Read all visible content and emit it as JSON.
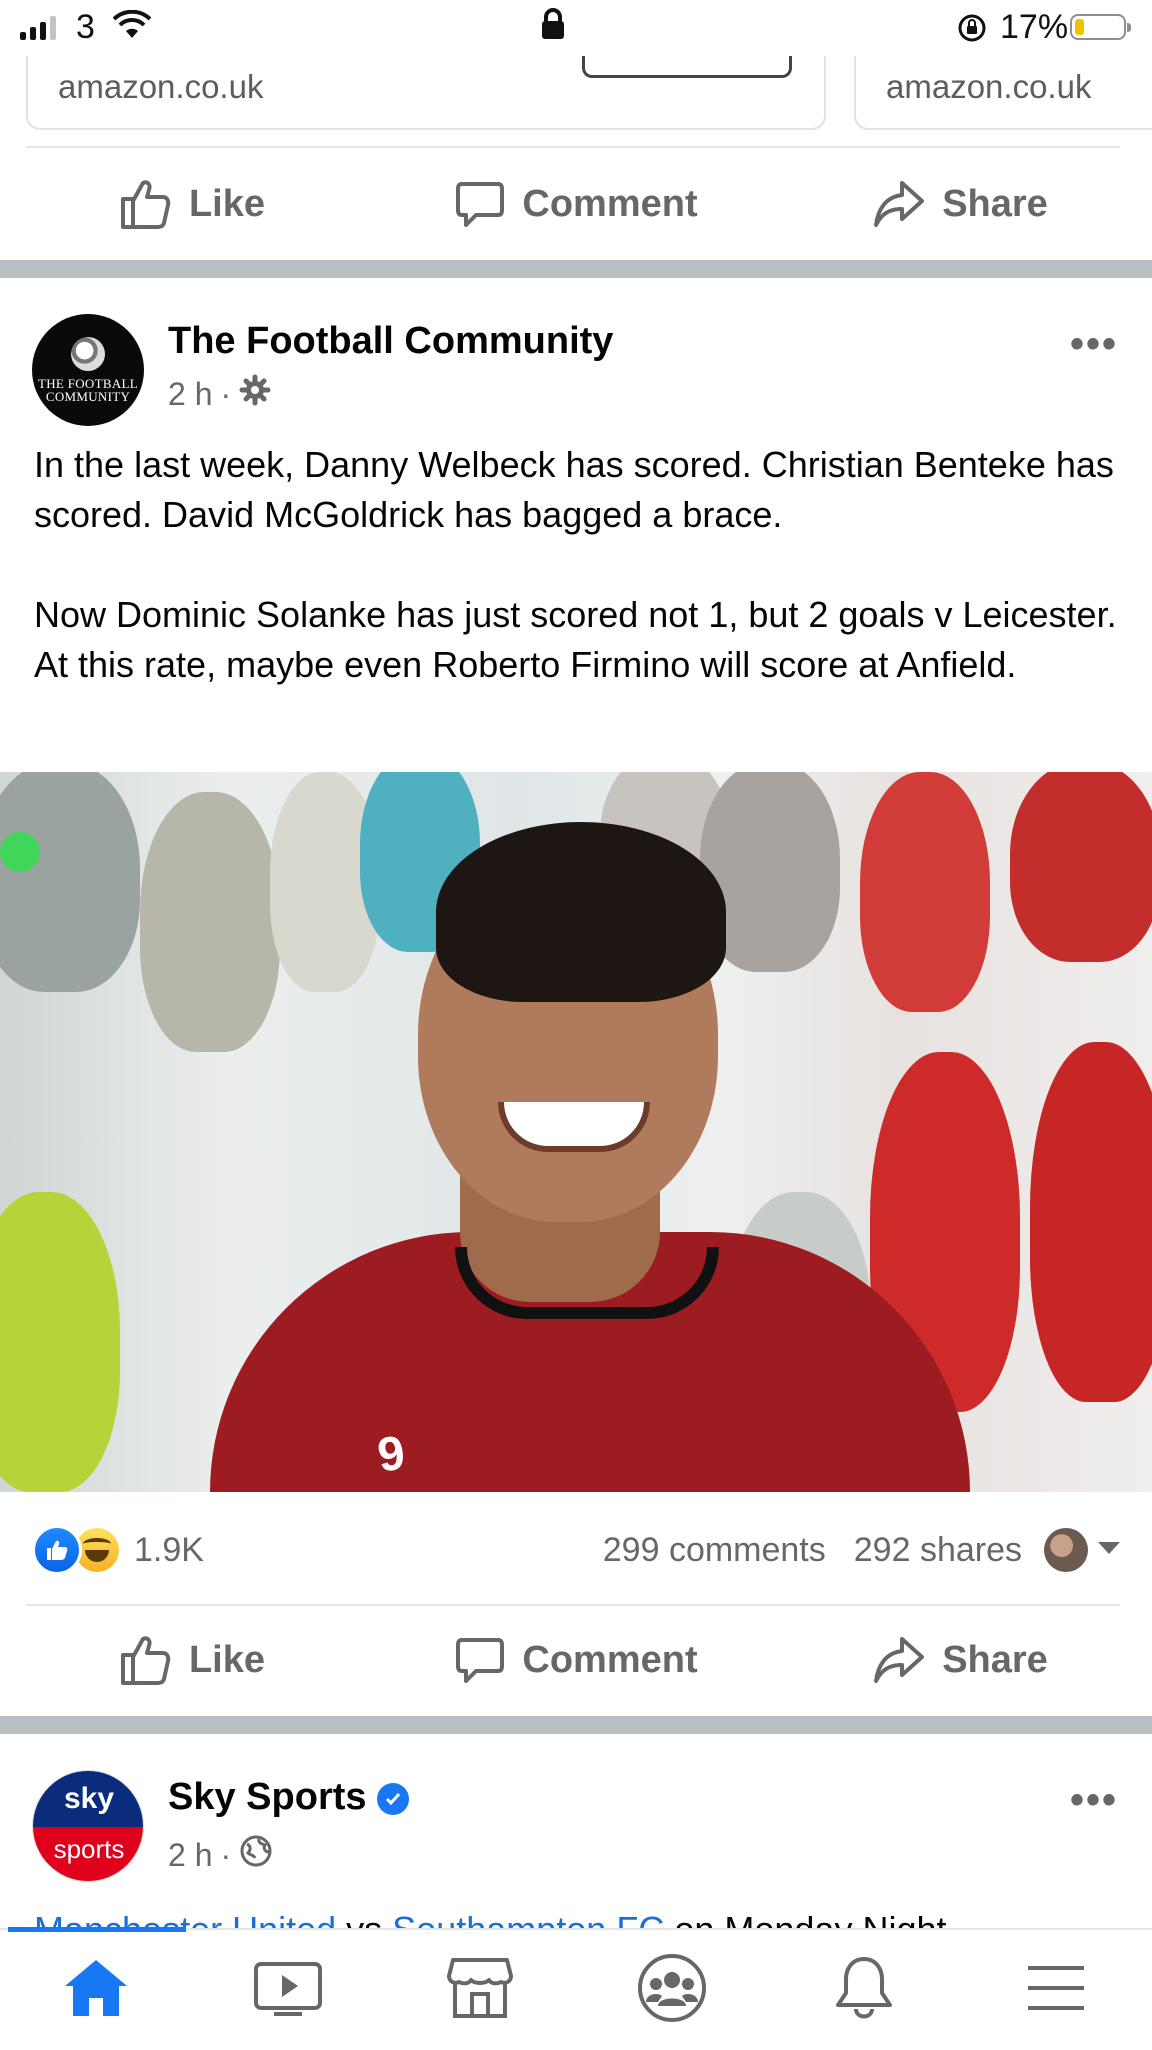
{
  "status_bar": {
    "carrier": "3",
    "battery_pct": "17%"
  },
  "prev_post": {
    "ad_cards": [
      {
        "domain": "amazon.co.uk"
      },
      {
        "domain": "amazon.co.uk"
      }
    ],
    "actions": {
      "like": "Like",
      "comment": "Comment",
      "share": "Share"
    }
  },
  "post": {
    "page_name": "The Football Community",
    "avatar_text": [
      "THE FOOTBALL",
      "COMMUNITY"
    ],
    "time": "2 h",
    "visibility_icon": "gear-icon",
    "paragraphs": [
      "In the last week, Danny Welbeck has scored. Christian Benteke has scored. David McGoldrick has bagged a brace.",
      "Now Dominic Solanke has just scored not 1, but 2 goals v Leicester. At this rate, maybe even Roberto Firmino will score at Anfield."
    ],
    "photo_shirt_number": "9",
    "reactions_count": "1.9K",
    "comments": "299 comments",
    "shares": "292 shares",
    "actions": {
      "like": "Like",
      "comment": "Comment",
      "share": "Share"
    }
  },
  "next_post": {
    "page_name": "Sky Sports",
    "avatar_top": "sky",
    "avatar_bottom": "sports",
    "time": "2 h",
    "visibility_icon": "globe-icon",
    "link1": "Manchester United",
    "mid": " vs ",
    "link2": "Southampton FC",
    "rest": " on Monday Night"
  },
  "nav": {
    "items": [
      "home-icon",
      "video-icon",
      "marketplace-icon",
      "groups-icon",
      "notifications-icon",
      "menu-icon"
    ],
    "active": "home-icon"
  },
  "colors": {
    "accent": "#1877f2",
    "muted": "#65676b",
    "separator": "#b9bec5"
  }
}
